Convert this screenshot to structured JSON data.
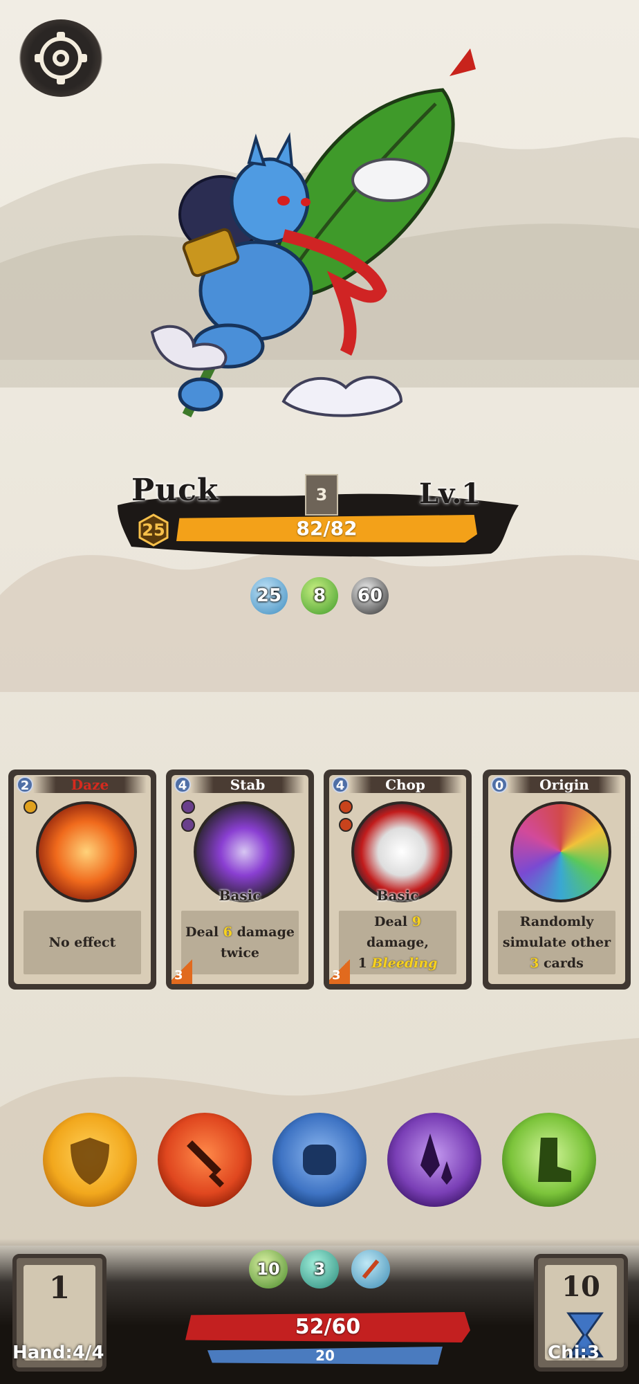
{
  "enemy": {
    "name": "Puck",
    "level": "Lv.1",
    "turn_counter": "3",
    "shield": "25",
    "hp_text": "82/82",
    "stats": [
      {
        "icon": "water-drop-icon",
        "value": "25"
      },
      {
        "icon": "gourd-icon",
        "value": "8"
      },
      {
        "icon": "yin-yang-icon",
        "value": "60"
      }
    ]
  },
  "cards": [
    {
      "cost": "2",
      "title": "Daze",
      "title_color": "#d62a1e",
      "type": "",
      "desc_plain": "No effect",
      "corner": ""
    },
    {
      "cost": "4",
      "title": "Stab",
      "title_color": "#ffffff",
      "type": "Basic",
      "desc_pre": "Deal ",
      "desc_num": "6",
      "desc_post": " damage twice",
      "corner": "3"
    },
    {
      "cost": "4",
      "title": "Chop",
      "title_color": "#ffffff",
      "type": "Basic",
      "desc_pre": "Deal ",
      "desc_num": "9",
      "desc_post": " damage,",
      "desc_line2_num": "1",
      "desc_line2_key": "Bleeding",
      "corner": "3"
    },
    {
      "cost": "0",
      "title": "Origin",
      "title_color": "#ffffff",
      "type": "",
      "desc_pre": "Randomly simulate other ",
      "desc_num": "3",
      "desc_post": " cards",
      "corner": ""
    }
  ],
  "actions": [
    {
      "icon": "shield-icon",
      "color": "#f2a81d"
    },
    {
      "icon": "sword-icon",
      "color": "#e0471f"
    },
    {
      "icon": "fist-icon",
      "color": "#3f74c4"
    },
    {
      "icon": "blade-icon",
      "color": "#7a3fb6"
    },
    {
      "icon": "boot-icon",
      "color": "#7cc43b"
    }
  ],
  "player": {
    "deck_count": "1",
    "hand_label": "Hand:4/4",
    "hp_text": "52/60",
    "shield_text": "20",
    "chi_count": "10",
    "chi_label": "Chi:3",
    "resources": [
      {
        "icon": "scroll-icon",
        "value": "10"
      },
      {
        "icon": "token-icon",
        "value": "3"
      },
      {
        "icon": "staff-icon",
        "value": ""
      }
    ]
  }
}
